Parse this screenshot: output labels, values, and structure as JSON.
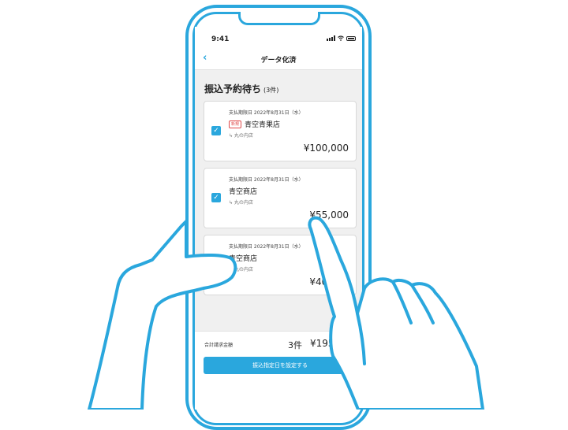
{
  "status_bar": {
    "time": "9:41",
    "icons": [
      "signal-icon",
      "wifi-icon",
      "battery-icon"
    ]
  },
  "nav": {
    "back_icon": "chevron-left-icon",
    "back_glyph": "‹",
    "title": "データ化済"
  },
  "section": {
    "title": "振込予約待ち",
    "count": "(3件)"
  },
  "invoices": [
    {
      "due": "支払期限日 2022年8月31日（水）",
      "badge": "新規",
      "name": "青空青果店",
      "branch": "↳ 丸の内店",
      "amount": "¥100,000",
      "checked": true
    },
    {
      "due": "支払期限日 2022年8月31日（水）",
      "badge": "",
      "name": "青空商店",
      "branch": "↳ 丸の内店",
      "amount": "¥55,000",
      "checked": true
    },
    {
      "due": "支払期限日 2022年8月31日（水）",
      "badge": "",
      "name": "青空商店",
      "branch": "↳ 丸の内店",
      "amount": "¥40,000",
      "checked": false
    }
  ],
  "footer": {
    "total_label": "合計請求金額",
    "total_count": "3件",
    "total_amount": "¥195,000",
    "submit_label": "振込指定日を設定する"
  },
  "colors": {
    "accent": "#2aa7dd",
    "screen_bg": "#f0f0f0",
    "new_badge": "#e04a4a"
  }
}
